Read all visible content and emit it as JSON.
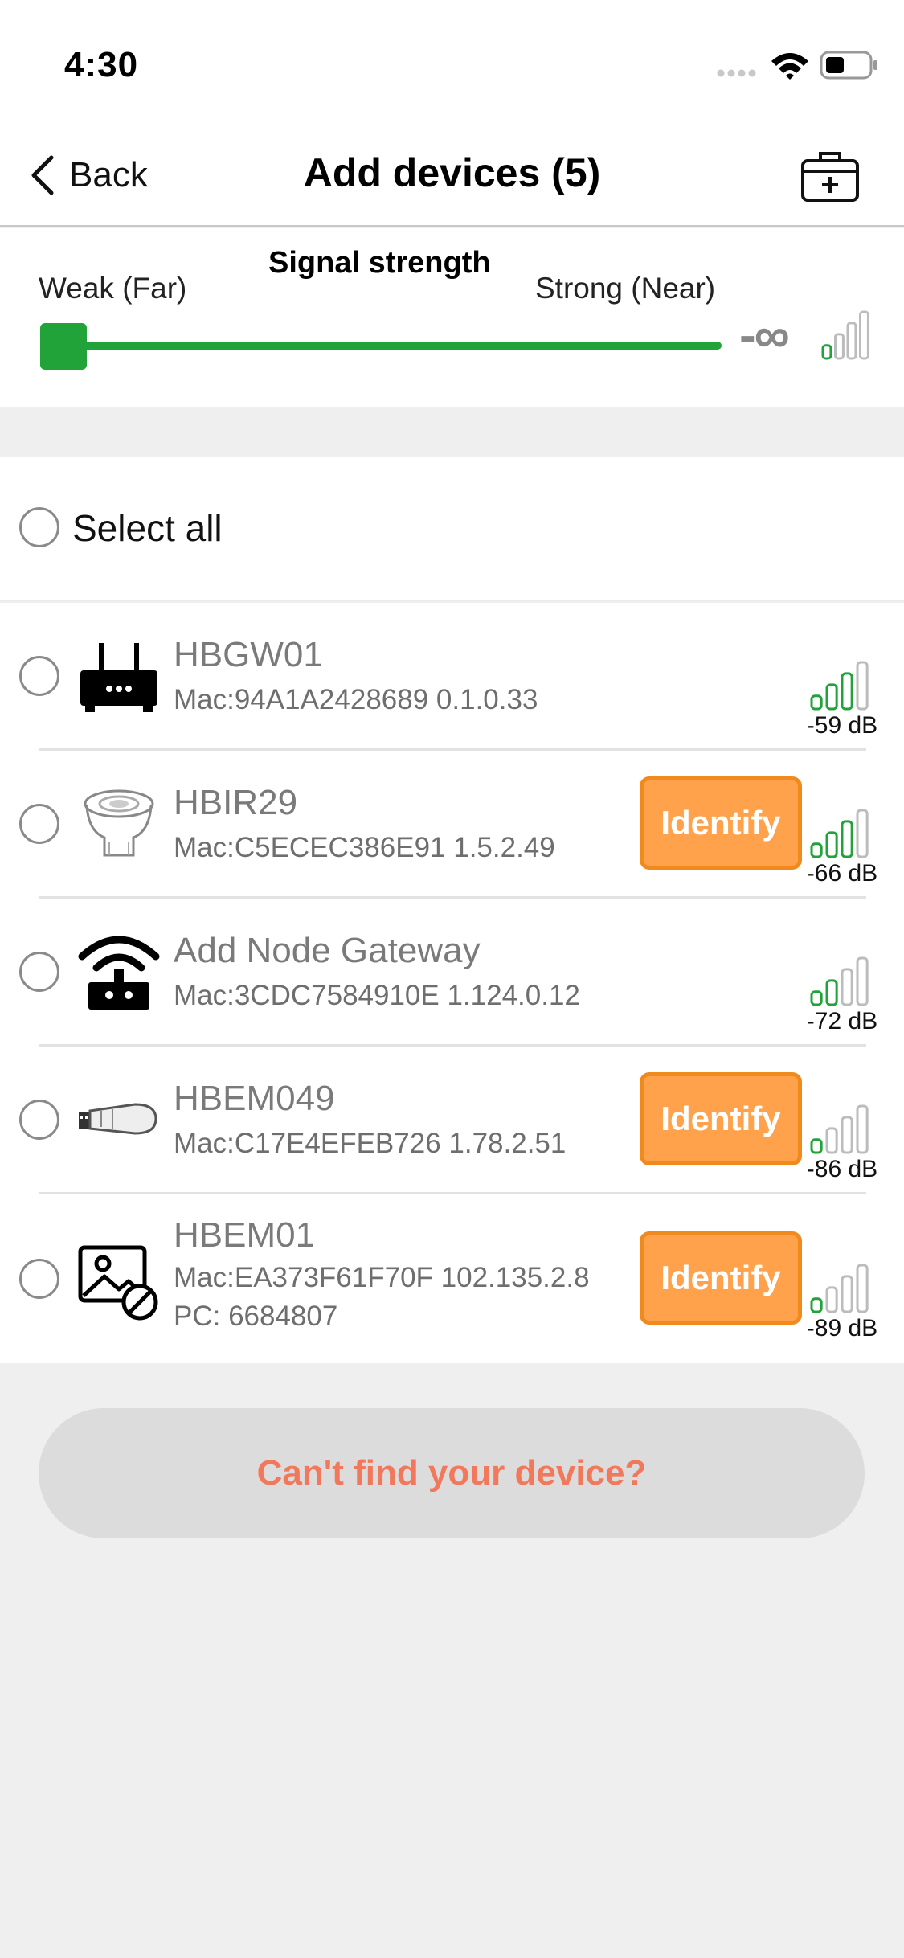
{
  "status_bar": {
    "time": "4:30"
  },
  "nav": {
    "back_label": "Back",
    "title": "Add devices (5)"
  },
  "signal": {
    "title": "Signal strength",
    "weak_label": "Weak (Far)",
    "strong_label": "Strong (Near)",
    "value_text": "-∞",
    "slider_fraction": 0.0,
    "bars_level": 1
  },
  "select_all": {
    "label": "Select all"
  },
  "devices": [
    {
      "name": "HBGW01",
      "mac": "Mac:94A1A2428689  0.1.0.33",
      "pc": "",
      "identify_label": "",
      "db": "-59 dB",
      "bars": 3,
      "icon": "router-icon"
    },
    {
      "name": "HBIR29",
      "mac": "Mac:C5ECEC386E91  1.5.2.49",
      "pc": "",
      "identify_label": "Identify",
      "db": "-66 dB",
      "bars": 3,
      "icon": "ir-sensor-icon"
    },
    {
      "name": "Add Node Gateway",
      "mac": "Mac:3CDC7584910E  1.124.0.12",
      "pc": "",
      "identify_label": "",
      "db": "-72 dB",
      "bars": 2,
      "icon": "wifi-gateway-icon"
    },
    {
      "name": "HBEM049",
      "mac": "Mac:C17E4EFEB726  1.78.2.51",
      "pc": "",
      "identify_label": "Identify",
      "db": "-86 dB",
      "bars": 1,
      "icon": "usb-dongle-icon"
    },
    {
      "name": "HBEM01",
      "mac": "Mac:EA373F61F70F  102.135.2.8",
      "pc": "PC: 6684807",
      "identify_label": "Identify",
      "db": "-89 dB",
      "bars": 1,
      "icon": "no-image-icon"
    }
  ],
  "footer": {
    "cant_find_label": "Can't find your device?"
  },
  "colors": {
    "accent_green": "#22a33a",
    "identify_orange": "#ffa24b",
    "identify_border": "#f08a1d",
    "cant_find_text": "#f2785c"
  }
}
